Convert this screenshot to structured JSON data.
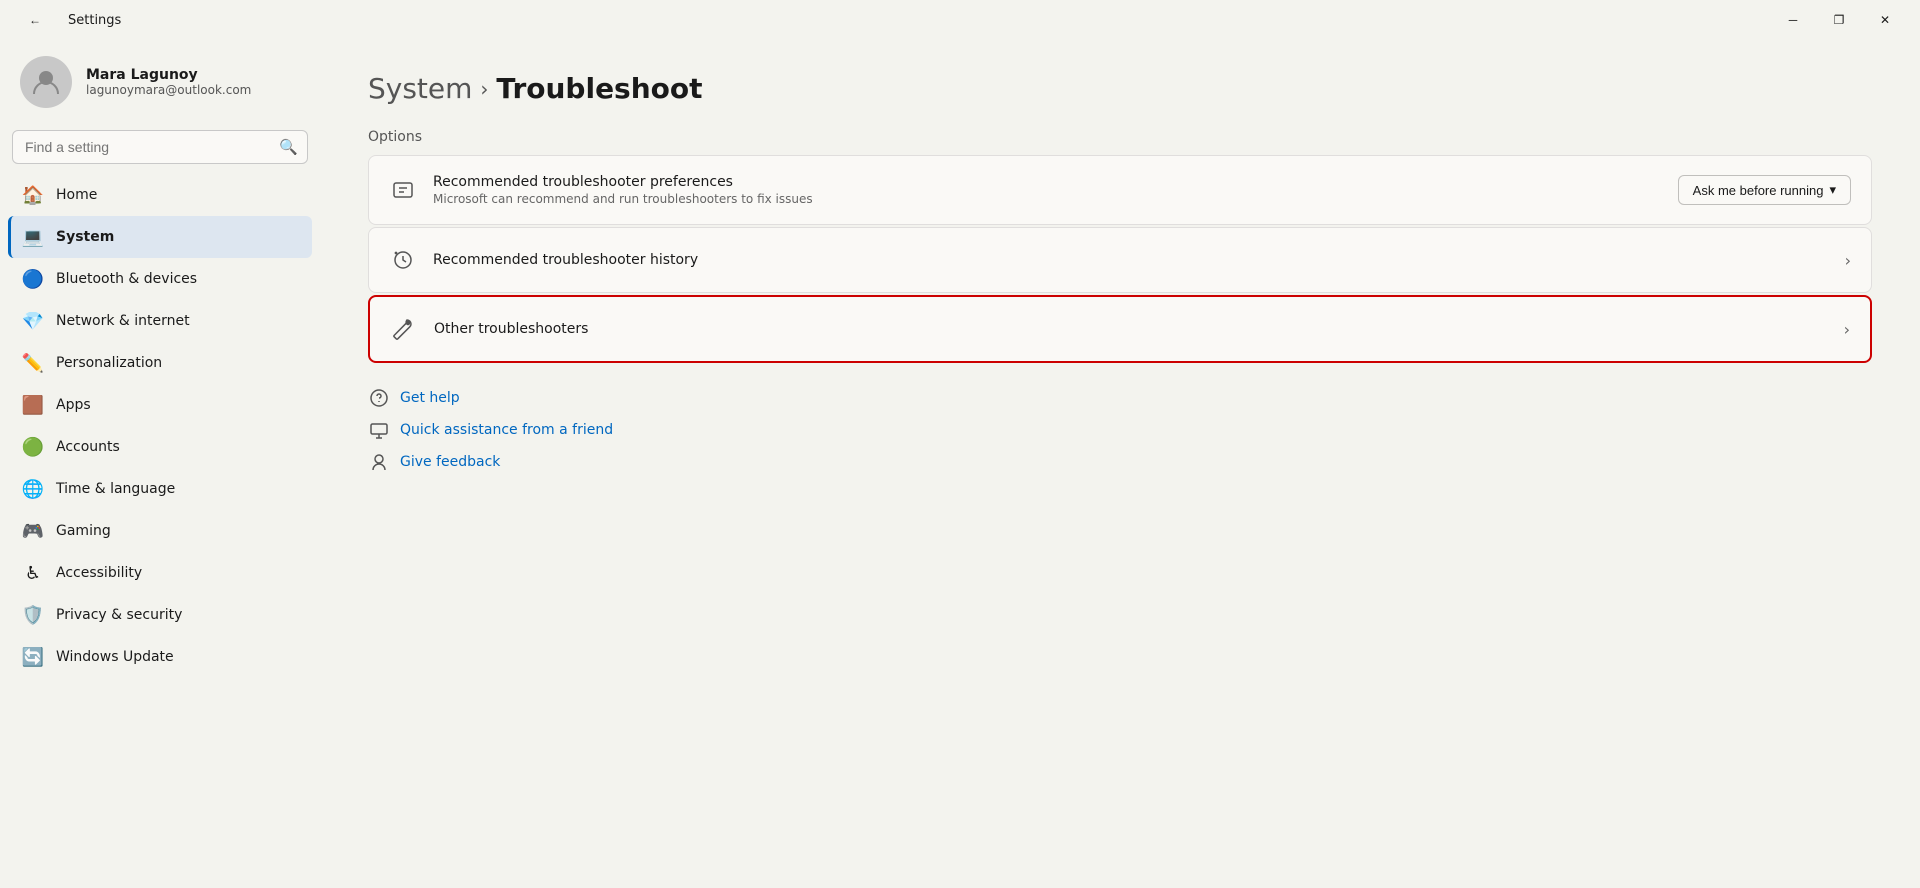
{
  "titlebar": {
    "title": "Settings",
    "back_icon": "←",
    "minimize_icon": "─",
    "maximize_icon": "❐",
    "close_icon": "✕"
  },
  "sidebar": {
    "user": {
      "name": "Mara Lagunoy",
      "email": "lagunoymara@outlook.com"
    },
    "search_placeholder": "Find a setting",
    "nav_items": [
      {
        "id": "home",
        "label": "Home",
        "icon": "🏠",
        "active": false
      },
      {
        "id": "system",
        "label": "System",
        "icon": "💻",
        "active": true
      },
      {
        "id": "bluetooth",
        "label": "Bluetooth & devices",
        "icon": "🔵",
        "active": false
      },
      {
        "id": "network",
        "label": "Network & internet",
        "icon": "💎",
        "active": false
      },
      {
        "id": "personalization",
        "label": "Personalization",
        "icon": "✏️",
        "active": false
      },
      {
        "id": "apps",
        "label": "Apps",
        "icon": "🟫",
        "active": false
      },
      {
        "id": "accounts",
        "label": "Accounts",
        "icon": "🟢",
        "active": false
      },
      {
        "id": "time",
        "label": "Time & language",
        "icon": "🌐",
        "active": false
      },
      {
        "id": "gaming",
        "label": "Gaming",
        "icon": "🎮",
        "active": false
      },
      {
        "id": "accessibility",
        "label": "Accessibility",
        "icon": "♿",
        "active": false
      },
      {
        "id": "privacy",
        "label": "Privacy & security",
        "icon": "🛡️",
        "active": false
      },
      {
        "id": "update",
        "label": "Windows Update",
        "icon": "🔄",
        "active": false
      }
    ]
  },
  "main": {
    "breadcrumb_parent": "System",
    "breadcrumb_separator": "›",
    "breadcrumb_current": "Troubleshoot",
    "section_label": "Options",
    "options": [
      {
        "id": "recommended-prefs",
        "icon": "💬",
        "title": "Recommended troubleshooter preferences",
        "desc": "Microsoft can recommend and run troubleshooters to fix issues",
        "dropdown_label": "Ask me before running",
        "has_dropdown": true,
        "highlighted": false
      },
      {
        "id": "recommended-history",
        "icon": "🕐",
        "title": "Recommended troubleshooter history",
        "desc": "",
        "has_chevron": true,
        "highlighted": false
      },
      {
        "id": "other-troubleshooters",
        "icon": "🔧",
        "title": "Other troubleshooters",
        "desc": "",
        "has_chevron": true,
        "highlighted": true
      }
    ],
    "links": [
      {
        "id": "get-help",
        "icon": "🔍",
        "label": "Get help"
      },
      {
        "id": "quick-assistance",
        "icon": "🖥️",
        "label": "Quick assistance from a friend"
      },
      {
        "id": "give-feedback",
        "icon": "👤",
        "label": "Give feedback"
      }
    ]
  }
}
